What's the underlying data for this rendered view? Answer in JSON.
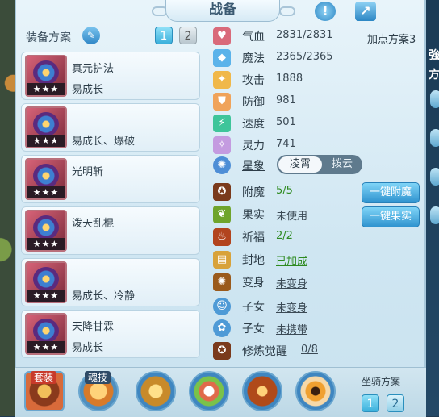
{
  "header": {
    "title": "战备"
  },
  "equip": {
    "section_label": "装备方案",
    "pages": [
      "1",
      "2"
    ],
    "items": [
      {
        "name": "真元护法",
        "sub": "易成长",
        "stars": "★★★"
      },
      {
        "name": "",
        "sub": "易成长、爆破",
        "stars": "★★★"
      },
      {
        "name": "光明斩",
        "sub": "",
        "stars": "★★★"
      },
      {
        "name": "泼天乱棍",
        "sub": "",
        "stars": "★★★"
      },
      {
        "name": "",
        "sub": "易成长、冷静",
        "stars": "★★★"
      },
      {
        "name": "天降甘霖",
        "sub": "易成长",
        "stars": "★★★"
      }
    ]
  },
  "stats": {
    "add_plan": "加点方案3",
    "rows": [
      {
        "label": "气血",
        "value": "2831/2831",
        "icon": "heart-icon"
      },
      {
        "label": "魔法",
        "value": "2365/2365",
        "icon": "diamond-icon"
      },
      {
        "label": "攻击",
        "value": "1888",
        "icon": "attack-icon"
      },
      {
        "label": "防御",
        "value": "981",
        "icon": "shield-icon"
      },
      {
        "label": "速度",
        "value": "501",
        "icon": "speed-icon"
      },
      {
        "label": "灵力",
        "value": "741",
        "icon": "spirit-icon"
      }
    ],
    "star": {
      "label": "星象",
      "opt_a": "凌霄",
      "opt_b": "拨云"
    }
  },
  "extras": {
    "rows": [
      {
        "label": "附魔",
        "value": "5/5"
      },
      {
        "label": "果实",
        "value": "未使用"
      },
      {
        "label": "祈福",
        "value": "2/2"
      },
      {
        "label": "封地",
        "value": "已加成"
      },
      {
        "label": "变身",
        "value": "未变身"
      },
      {
        "label": "子女",
        "value": "未变身"
      },
      {
        "label": "子女",
        "value": "未携带"
      },
      {
        "label": "修炼觉醒",
        "value": "0/8"
      }
    ],
    "btn_enchant": "一键附魔",
    "btn_fruit": "一键果实"
  },
  "bottom": {
    "tag_set": "套装",
    "tag_skill": "魂技",
    "mount_label": "坐骑方案",
    "mount_pages": [
      "1",
      "2"
    ]
  },
  "edge": {
    "chars": [
      "強",
      "方"
    ]
  },
  "colors": {
    "accent": "#2f93cf",
    "green": "#2d8a1f"
  }
}
